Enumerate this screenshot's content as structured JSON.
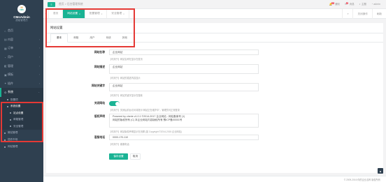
{
  "sidebar": {
    "avatar_line1": "M",
    "avatar_line2": "CMS",
    "user_name": "CMsAdmin",
    "user_role": "超级管理员",
    "items": [
      {
        "label": "首页",
        "icon": "home-icon",
        "glyph": "⌂"
      },
      {
        "label": "内容",
        "icon": "document-icon",
        "glyph": "▤"
      },
      {
        "label": "订单",
        "icon": "cart-icon",
        "glyph": "▦"
      },
      {
        "label": "用户",
        "icon": "user-icon",
        "glyph": "◔"
      },
      {
        "label": "管理",
        "icon": "settings-icon",
        "glyph": "◧"
      },
      {
        "label": "模板",
        "icon": "template-icon",
        "glyph": "▣"
      },
      {
        "label": "插件",
        "icon": "plugin-icon",
        "glyph": "✦"
      }
    ],
    "open_item": {
      "label": "系统",
      "icon": "system-icon",
      "glyph": "✿"
    },
    "sub_items": [
      {
        "label": "配置项"
      },
      {
        "label": "系统设置"
      },
      {
        "label": "站点设置"
      },
      {
        "label": "邮箱管理"
      },
      {
        "label": "安全管理"
      }
    ],
    "after_items": [
      {
        "label": "微站管理"
      },
      {
        "label": "插件市场"
      },
      {
        "label": "网站管理"
      }
    ]
  },
  "topbar": {
    "menu_glyph": "≡",
    "breadcrumb": "首页 > 后台管理系统",
    "right_items": [
      {
        "label": "通知",
        "badge": "8"
      },
      {
        "label": "消息",
        "badge": "2"
      },
      {
        "label": "主题",
        "badge": ""
      },
      {
        "label": "admin",
        "badge": ""
      }
    ]
  },
  "tabs": {
    "prev_glyph": "«",
    "next_glyph": "»",
    "items": [
      {
        "label": "首页",
        "active": false
      },
      {
        "label": "网站设置",
        "active": true
      },
      {
        "label": "配置管理",
        "active": false
      },
      {
        "label": "安全管理",
        "active": false
      }
    ],
    "close_glyph": "×",
    "tools": [
      "关闭操作",
      "刷新"
    ]
  },
  "card": {
    "title": "网站设置",
    "form_tabs": [
      "基本",
      "邮箱",
      "用户",
      "系统",
      "其他"
    ]
  },
  "form": {
    "site_name_label": "网站名称",
    "site_name_value": "企业网站",
    "site_name_help": "【可用于】网站名称在显示在首页",
    "site_desc_label": "网站描述",
    "site_desc_value": "企业网站",
    "site_desc_help": "【可用于】网站的描述内容显示",
    "site_keywords_label": "网站关键字",
    "site_keywords_value": "企业网站",
    "site_keywords_help": "【可用于】网站关键字显示在搜索",
    "close_site_label": "关闭网站",
    "close_site_help": "【可用于】关闭后前台访问将提示“网站正在维护中”，管理员可正常登录",
    "copyright_label": "版权声明",
    "copyright_value": "Powered by cherie v1.0.1 ©2014-2017 企业网站 - 网站备案号 (1)\n网站的版权所有 (C) 本企业网站内容版权所有 豫ICP备00001号",
    "copyright_help": "【可用于】网站版权声明显示在页脚 (如 Copyright ©2014-2015 企业网站)",
    "phone_label": "客服电话",
    "phone_value": "0000-170-110",
    "phone_help": "【可用于】客服电话",
    "save_label": "保存设置",
    "cancel_label": "取消"
  },
  "footer": {
    "text": "© 2009-2016 你的企业名称 版权所有"
  },
  "scroll_top_glyph": "▲",
  "colors": {
    "sidebar_bg": "#2f4050",
    "accent": "#1ab394",
    "highlight": "#e53935"
  }
}
